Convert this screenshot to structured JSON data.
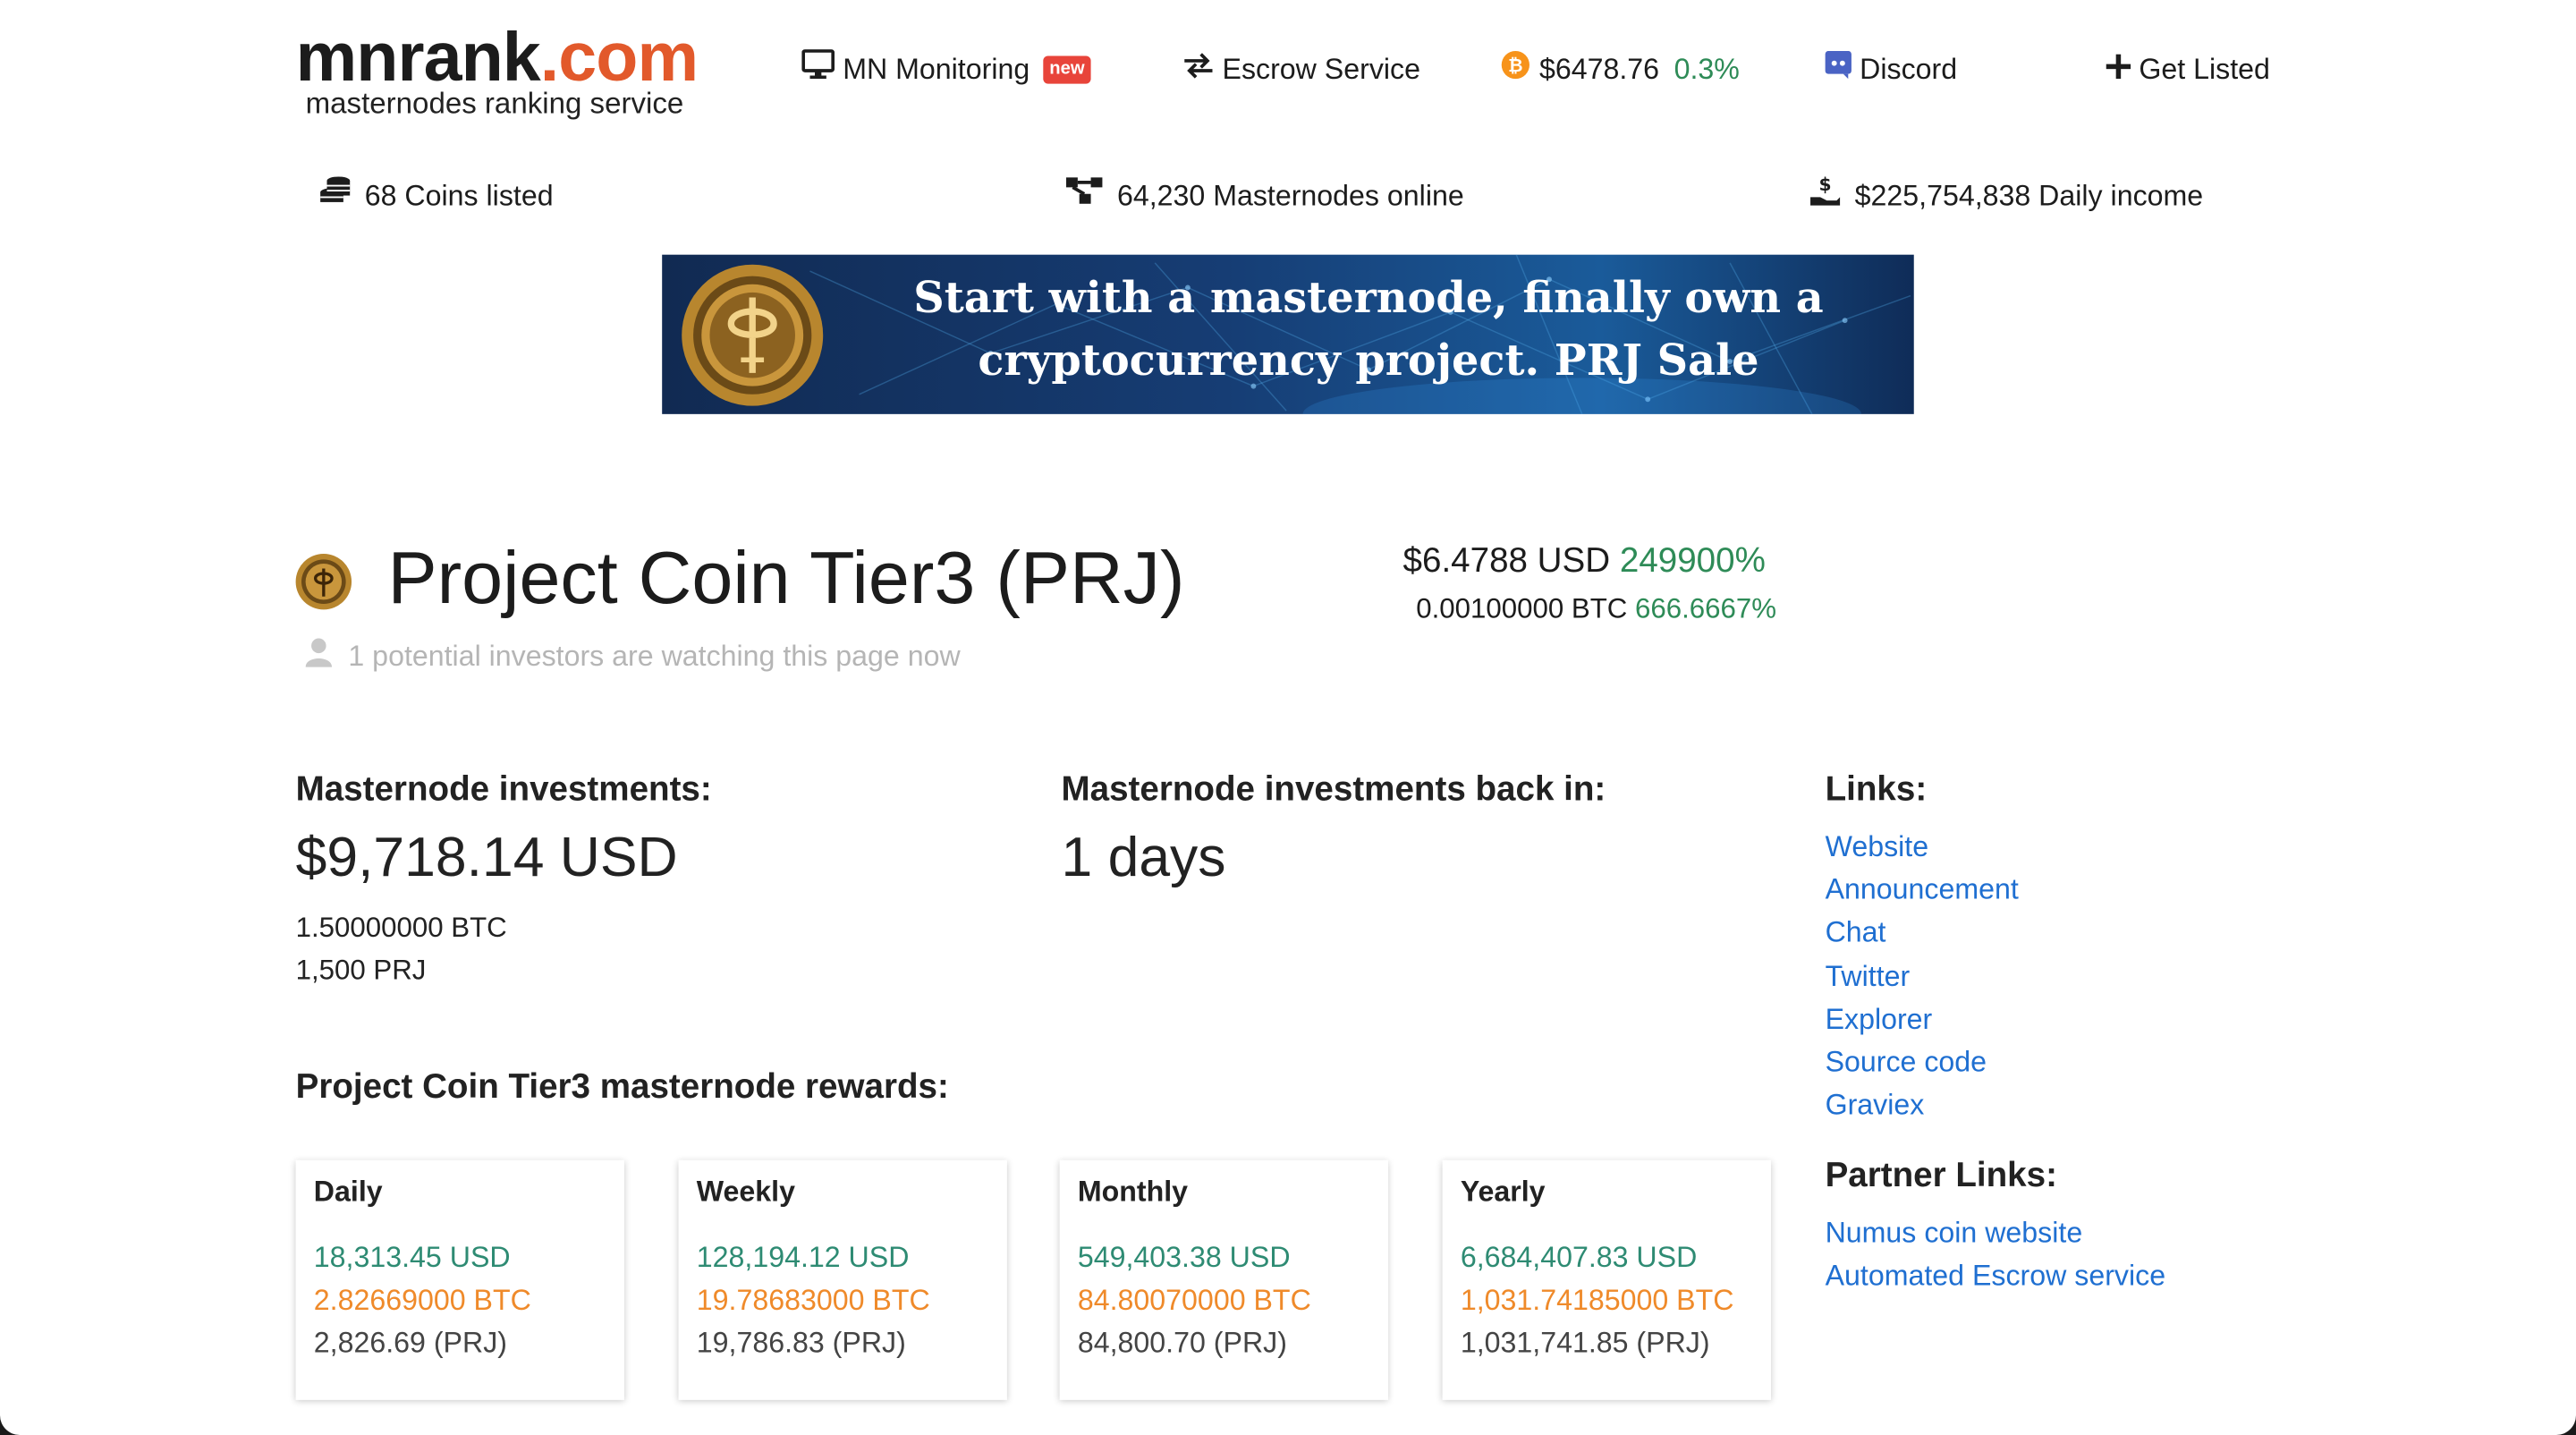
{
  "header": {
    "logo_main": "mnrank",
    "logo_tld": ".com",
    "logo_sub": "masternodes ranking service",
    "nav": {
      "monitoring": "MN Monitoring",
      "monitoring_badge": "new",
      "escrow": "Escrow Service",
      "btc_price": "$6478.76",
      "btc_change": "0.3%",
      "discord": "Discord",
      "get_listed": "Get Listed"
    }
  },
  "stats": {
    "coins": "68 Coins listed",
    "masternodes": "64,230 Masternodes online",
    "income": "$225,754,838 Daily income"
  },
  "banner": {
    "line1": "Start with a masternode, finally own a",
    "line2": "cryptocurrency project. PRJ Sale"
  },
  "coin": {
    "title": "Project Coin Tier3 (PRJ)",
    "watching": "1 potential investors are watching this page now",
    "price_usd": "$6.4788 USD",
    "price_usd_change": "249900%",
    "price_btc": "0.00100000 BTC",
    "price_btc_change": "666.6667%"
  },
  "investment": {
    "heading": "Masternode investments:",
    "usd": "$9,718.14 USD",
    "btc": "1.50000000 BTC",
    "coins": "1,500 PRJ"
  },
  "payback": {
    "heading": "Masternode investments back in:",
    "value": "1 days"
  },
  "links": {
    "heading": "Links:",
    "items": [
      "Website",
      "Announcement",
      "Chat",
      "Twitter",
      "Explorer",
      "Source code",
      "Graviex"
    ]
  },
  "partner_links": {
    "heading": "Partner Links:",
    "items": [
      "Numus coin website",
      "Automated Escrow service"
    ]
  },
  "rewards": {
    "heading": "Project Coin Tier3 masternode rewards:",
    "cards": [
      {
        "period": "Daily",
        "usd": "18,313.45 USD",
        "btc": "2.82669000 BTC",
        "coin": "2,826.69 (PRJ)"
      },
      {
        "period": "Weekly",
        "usd": "128,194.12 USD",
        "btc": "19.78683000 BTC",
        "coin": "19,786.83 (PRJ)"
      },
      {
        "period": "Monthly",
        "usd": "549,403.38 USD",
        "btc": "84.80070000 BTC",
        "coin": "84,800.70 (PRJ)"
      },
      {
        "period": "Yearly",
        "usd": "6,684,407.83 USD",
        "btc": "1,031.74185000 BTC",
        "coin": "1,031,741.85 (PRJ)"
      }
    ]
  },
  "colors": {
    "brand_orange": "#e2592b",
    "link_blue": "#1f6fd1",
    "positive_green": "#2e8b57",
    "btc_orange": "#ef8a2a"
  }
}
